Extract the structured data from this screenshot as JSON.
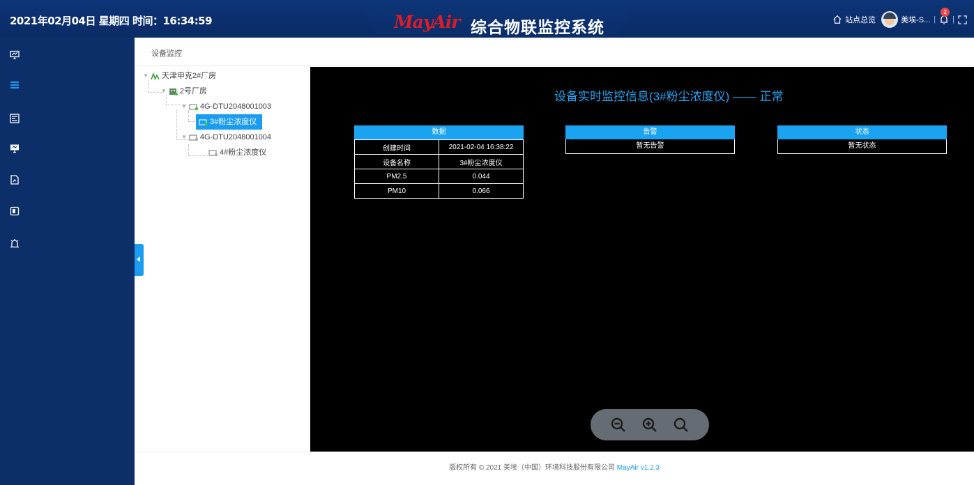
{
  "header": {
    "datetime": "2021年02月04日 星期四 时间：16:34:59",
    "logo": "MayAir",
    "title": "综合物联监控系统",
    "overview_label": "站点总览",
    "user_name": "美埃-S...",
    "sep": "|",
    "notification_count": "2"
  },
  "sidebar": {
    "icons": [
      "monitor-icon",
      "list-icon",
      "dashboard-icon",
      "screen-icon",
      "report-icon",
      "device-icon",
      "alarm-icon"
    ]
  },
  "breadcrumb": "设备监控",
  "tree": [
    {
      "label": "天津申克2#厂房",
      "level": 0
    },
    {
      "label": "2号厂房",
      "level": 1
    },
    {
      "label": "4G-DTU2048001003",
      "level": 2
    },
    {
      "label": "3#粉尘浓度仪",
      "level": 3,
      "selected": true
    },
    {
      "label": "4G-DTU2048001004",
      "level": 2
    },
    {
      "label": "4#粉尘浓度仪",
      "level": 3
    }
  ],
  "monitor": {
    "title": "设备实时监控信息(3#粉尘浓度仪) —— 正常",
    "data_panel": {
      "header": "数据",
      "rows": [
        [
          "创建时间",
          "2021-02-04 16:38:22"
        ],
        [
          "设备名称",
          "3#粉尘浓度仪"
        ],
        [
          "PM2.5",
          "0.044"
        ],
        [
          "PM10",
          "0.066"
        ]
      ]
    },
    "alarm_panel": {
      "header": "告警",
      "value": "暂无告警"
    },
    "status_panel": {
      "header": "状态",
      "value": "暂无状态"
    }
  },
  "footer": {
    "text": "版权所有 © 2021 美埃（中国）环境科技股份有限公司 ",
    "brand": "MayAir v1.2.3"
  },
  "colors": {
    "header_bg": "#0d3577",
    "accent": "#1a9cf0",
    "logo_red": "#e01b24"
  }
}
